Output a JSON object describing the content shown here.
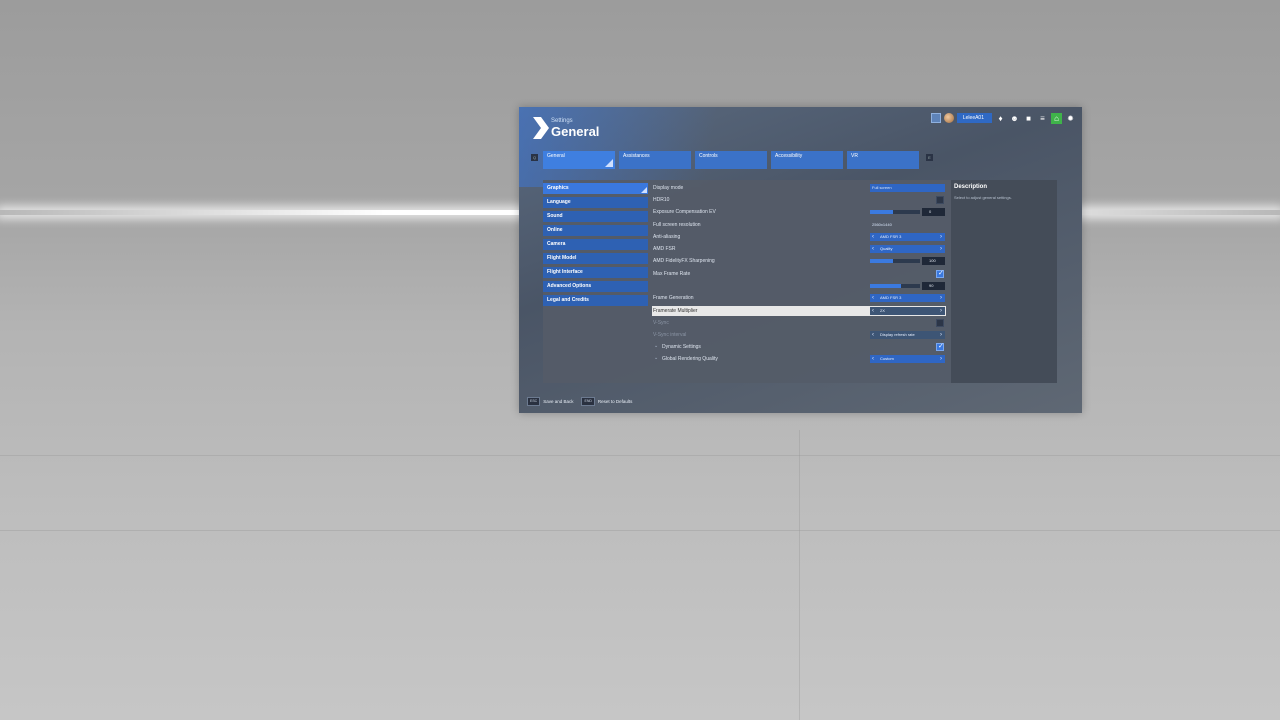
{
  "header": {
    "subtitle": "Settings",
    "title": "General"
  },
  "topbar": {
    "username": "LeleeA01",
    "icons": [
      "menu-icon",
      "avatar",
      "notification-icon",
      "friends-icon",
      "chat-icon",
      "marketplace-icon",
      "gear-icon"
    ]
  },
  "tabs": {
    "prev_key": "Q",
    "next_key": "E",
    "items": [
      {
        "label": "General",
        "active": true
      },
      {
        "label": "Assistances"
      },
      {
        "label": "Controls"
      },
      {
        "label": "Accessibility"
      },
      {
        "label": "VR"
      }
    ]
  },
  "sidebar": {
    "items": [
      {
        "label": "Graphics",
        "active": true
      },
      {
        "label": "Language"
      },
      {
        "label": "Sound"
      },
      {
        "label": "Online"
      },
      {
        "label": "Camera"
      },
      {
        "label": "Flight Model"
      },
      {
        "label": "Flight Interface"
      },
      {
        "label": "Advanced Options"
      },
      {
        "label": "Legal and Credits"
      }
    ]
  },
  "settings": [
    {
      "label": "Display mode",
      "value": "Full screen"
    },
    {
      "label": "HDR10",
      "checked": false
    },
    {
      "label": "Exposure Compensation EV",
      "value": "0",
      "level": 0.45
    },
    {
      "label": "Full screen resolution",
      "value": "2560x1440"
    },
    {
      "label": "Anti-aliasing",
      "value": "AMD FSR 3"
    },
    {
      "label": "AMD FSR",
      "value": "Quality"
    },
    {
      "label": "AMD FidelityFX Sharpening",
      "value": "100",
      "level": 0.45
    },
    {
      "label": "Max Frame Rate",
      "checked": true
    },
    {
      "label": "",
      "value": "90",
      "level": 0.62
    },
    {
      "label": "Frame Generation",
      "value": "AMD FSR 3"
    },
    {
      "label": "Framerate Multiplier",
      "value": "2X"
    },
    {
      "label": "V-Sync",
      "checked": false
    },
    {
      "label": "V-Sync interval",
      "value": "Display refresh rate"
    },
    {
      "label": "Dynamic Settings",
      "checked": true
    },
    {
      "label": "Global Rendering Quality",
      "value": "Custom"
    }
  ],
  "description": {
    "title": "Description",
    "text": "Select to adjust general settings."
  },
  "footer": {
    "save": {
      "key": "ESC",
      "label": "Save and Back"
    },
    "reset": {
      "key": "END",
      "label": "Reset to Defaults"
    }
  }
}
